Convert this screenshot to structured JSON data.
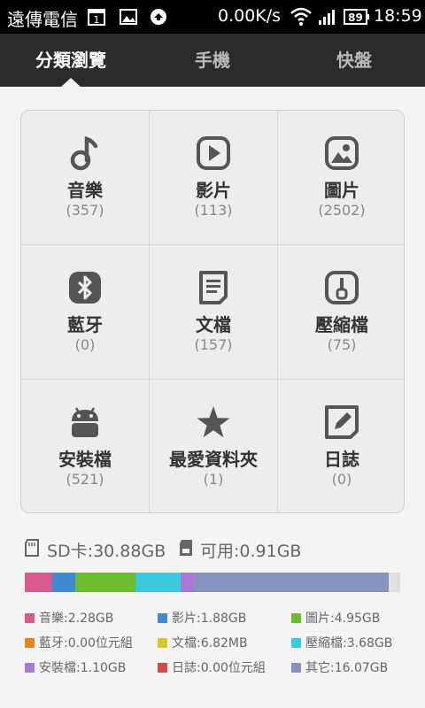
{
  "status_bar": {
    "carrier": "遠傳電信",
    "speed": "0.00K/s",
    "battery": "89",
    "time": "18:59"
  },
  "tabs": [
    {
      "label": "分類瀏覽",
      "active": true
    },
    {
      "label": "手機",
      "active": false
    },
    {
      "label": "快盤",
      "active": false
    }
  ],
  "categories": [
    {
      "label": "音樂",
      "count": "(357)",
      "icon": "music-icon"
    },
    {
      "label": "影片",
      "count": "(113)",
      "icon": "video-icon"
    },
    {
      "label": "圖片",
      "count": "(2502)",
      "icon": "image-icon"
    },
    {
      "label": "藍牙",
      "count": "(0)",
      "icon": "bluetooth-icon"
    },
    {
      "label": "文檔",
      "count": "(157)",
      "icon": "document-icon"
    },
    {
      "label": "壓縮檔",
      "count": "(75)",
      "icon": "archive-icon"
    },
    {
      "label": "安裝檔",
      "count": "(521)",
      "icon": "android-icon"
    },
    {
      "label": "最愛資料夾",
      "count": "(1)",
      "icon": "star-icon"
    },
    {
      "label": "日誌",
      "count": "(0)",
      "icon": "notes-icon"
    }
  ],
  "storage": {
    "sd_label": "SD卡:30.88GB",
    "available_label": "可用:0.91GB",
    "segments": [
      {
        "name": "音樂",
        "gb": 2.28,
        "color": "#d85a8f"
      },
      {
        "name": "影片",
        "gb": 1.88,
        "color": "#3f8bd0"
      },
      {
        "name": "圖片",
        "gb": 4.95,
        "color": "#6dbb2e"
      },
      {
        "name": "藍牙",
        "gb": 0.0,
        "color": "#e08a1e"
      },
      {
        "name": "文檔",
        "gb": 0.0066,
        "color": "#d7c62d"
      },
      {
        "name": "壓縮檔",
        "gb": 3.68,
        "color": "#3cc9dd"
      },
      {
        "name": "安裝檔",
        "gb": 1.1,
        "color": "#a77ad6"
      },
      {
        "name": "日誌",
        "gb": 0.0,
        "color": "#d94848"
      },
      {
        "name": "其它",
        "gb": 16.07,
        "color": "#8793bd"
      },
      {
        "name": "可用",
        "gb": 0.91,
        "color": "#e0e0e0"
      }
    ],
    "legend": [
      {
        "text": "音樂:2.28GB",
        "color": "#d85a8f"
      },
      {
        "text": "影片:1.88GB",
        "color": "#3f8bd0"
      },
      {
        "text": "圖片:4.95GB",
        "color": "#6dbb2e"
      },
      {
        "text": "藍牙:0.00位元組",
        "color": "#e08a1e"
      },
      {
        "text": "文檔:6.82MB",
        "color": "#d7c62d"
      },
      {
        "text": "壓縮檔:3.68GB",
        "color": "#3cc9dd"
      },
      {
        "text": "安裝檔:1.10GB",
        "color": "#a77ad6"
      },
      {
        "text": "日誌:0.00位元組",
        "color": "#d94848"
      },
      {
        "text": "其它:16.07GB",
        "color": "#8793bd"
      }
    ]
  }
}
